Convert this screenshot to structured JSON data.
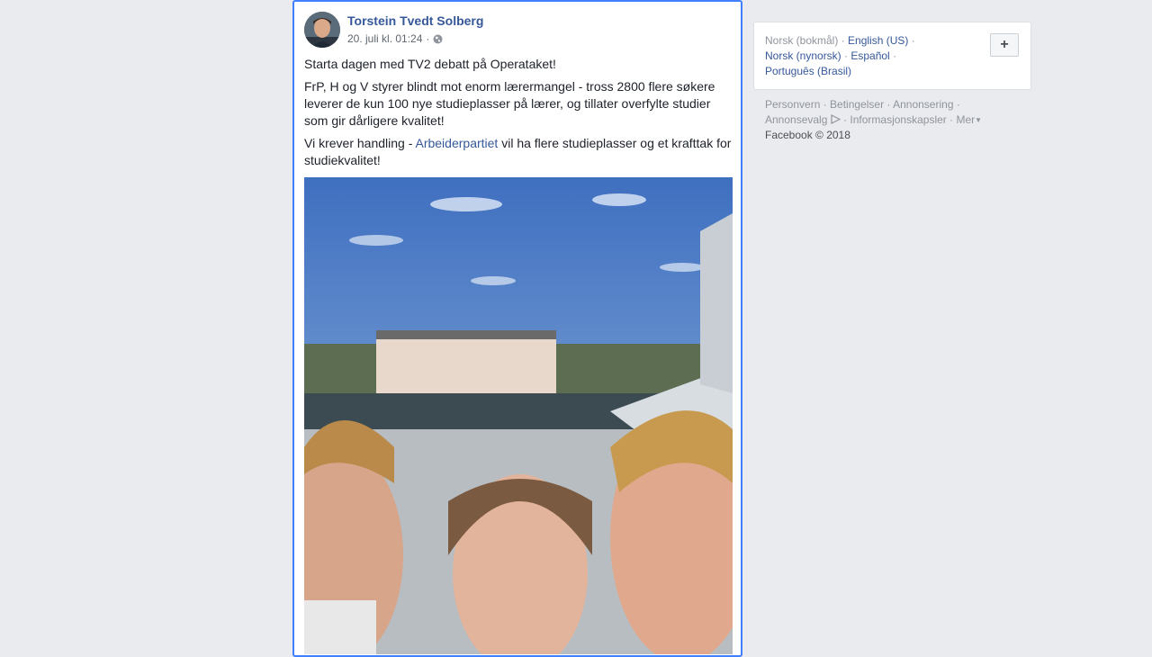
{
  "post": {
    "author": "Torstein Tvedt Solberg",
    "timestamp": "20. juli kl. 01:24",
    "separator": " ·",
    "privacy_icon": "globe-icon",
    "paragraph1": "Starta dagen med TV2 debatt på Operataket!",
    "paragraph2": "FrP, H og V styrer blindt mot enorm lærermangel - tross 2800 flere søkere leverer de kun 100 nye studieplasser på lærer, og tillater overfylte studier som gir dårligere kvalitet!",
    "paragraph3_pre": "Vi krever handling - ",
    "paragraph3_link": "Arbeiderpartiet",
    "paragraph3_post": " vil ha flere studieplasser og et krafttak for studiekvalitet!"
  },
  "languages": {
    "current": "Norsk (bokmål)",
    "options": [
      "English (US)",
      "Norsk (nynorsk)",
      "Español",
      "Português (Brasil)"
    ],
    "add_label": "+"
  },
  "footer": {
    "links": [
      "Personvern",
      "Betingelser",
      "Annonsering",
      "Annonsevalg",
      "Informasjonskapsler",
      "Mer"
    ],
    "copyright": "Facebook © 2018"
  },
  "colors": {
    "link": "#365899",
    "background": "#e9ebee",
    "focus_border": "#4080ff"
  }
}
